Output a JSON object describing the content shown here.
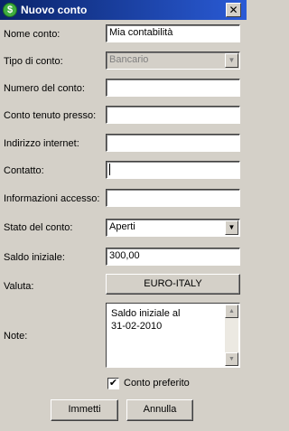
{
  "window": {
    "title": "Nuovo conto",
    "app_icon": "dollar-icon",
    "close_glyph": "✕"
  },
  "form": {
    "nome_conto": {
      "label": "Nome conto:",
      "value": "Mia contabilità"
    },
    "tipo_conto": {
      "label": "Tipo di conto:",
      "value": "Bancario"
    },
    "numero_conto": {
      "label": "Numero del conto:",
      "value": ""
    },
    "tenuto_presso": {
      "label": "Conto tenuto presso:",
      "value": ""
    },
    "indirizzo": {
      "label": "Indirizzo internet:",
      "value": ""
    },
    "contatto": {
      "label": "Contatto:",
      "value": ""
    },
    "accesso": {
      "label": "Informazioni accesso:",
      "value": ""
    },
    "stato": {
      "label": "Stato del conto:",
      "value": "Aperti"
    },
    "saldo": {
      "label": "Saldo iniziale:",
      "value": "300,00"
    },
    "valuta": {
      "label": "Valuta:",
      "value": "EURO-ITALY"
    },
    "note": {
      "label": "Note:",
      "line1": "Saldo iniziale al",
      "line2": "31-02-2010"
    },
    "preferito": {
      "label": "Conto preferito",
      "checked": true,
      "check_glyph": "✔"
    }
  },
  "buttons": {
    "immetti": "Immetti",
    "annulla": "Annulla"
  },
  "glyphs": {
    "dropdown": "▼",
    "scroll_up": "▲",
    "scroll_down": "▼"
  }
}
